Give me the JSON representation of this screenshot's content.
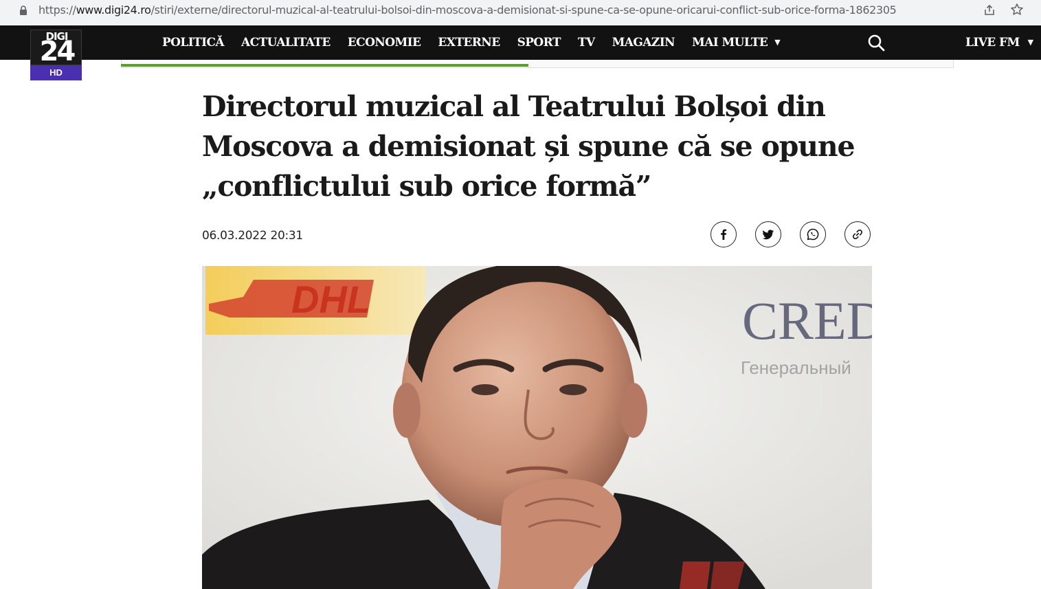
{
  "browser": {
    "url_scheme": "https://",
    "url_host": "www.digi24.ro",
    "url_path": "/stiri/externe/directorul-muzical-al-teatrului-bolsoi-din-moscova-a-demisionat-si-spune-ca-se-opune-oricarui-conflict-sub-orice-forma-1862305",
    "icons": [
      "lock-icon",
      "share-icon",
      "star-icon"
    ]
  },
  "header": {
    "logo_top": "DIGI",
    "logo_number": "24",
    "logo_badge": "HD",
    "nav": [
      {
        "label": "POLITICĂ"
      },
      {
        "label": "ACTUALITATE"
      },
      {
        "label": "ECONOMIE"
      },
      {
        "label": "EXTERNE"
      },
      {
        "label": "SPORT"
      },
      {
        "label": "TV"
      },
      {
        "label": "MAGAZIN"
      },
      {
        "label": "MAI MULTE"
      }
    ],
    "live_label": "LIVE FM",
    "colors": {
      "bar": "#121212",
      "hd_badge": "#4a2fb0",
      "ad_progress": "#5aa02c"
    }
  },
  "article": {
    "headline": "Directorul muzical al Teatrului Bolșoi din Moscova a demisionat și spune că se opune „conflictului sub orice formă”",
    "date": "06.03.2022 20:31",
    "share_buttons": [
      "facebook-icon",
      "twitter-icon",
      "whatsapp-icon",
      "link-icon"
    ],
    "photo": {
      "banner_left_text": "DHL",
      "banner_right_text": "CRED",
      "banner_right_subtext": "Генеральный"
    }
  }
}
